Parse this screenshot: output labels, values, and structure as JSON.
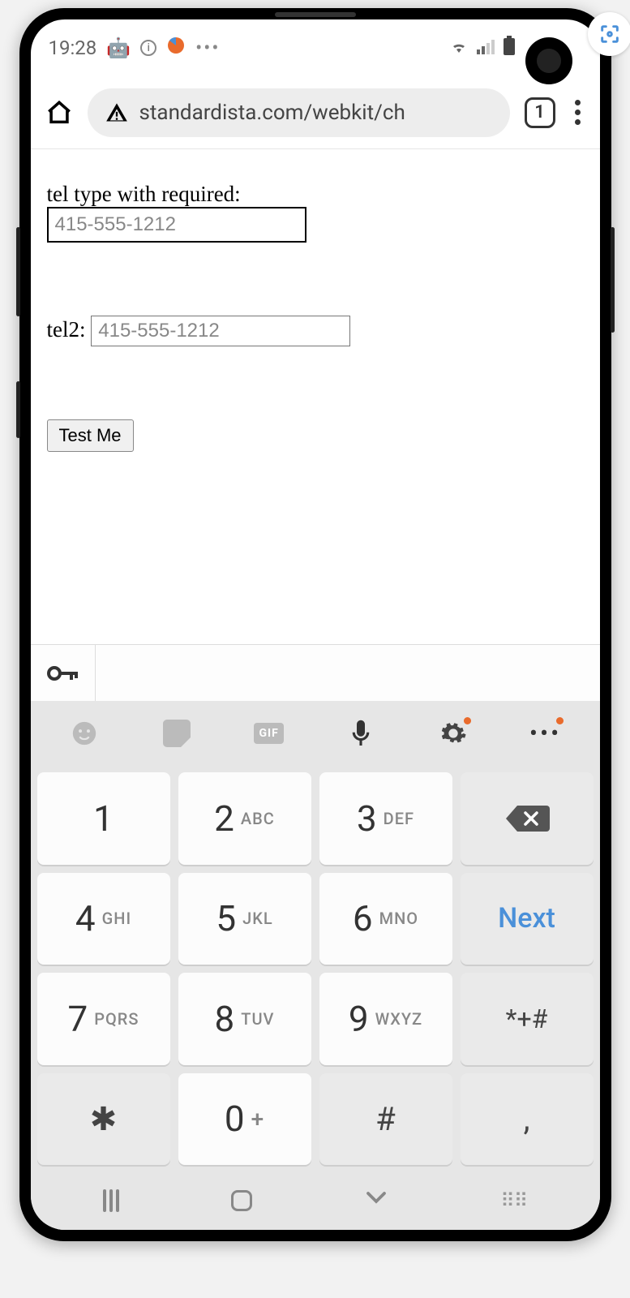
{
  "status": {
    "time": "19:28",
    "icons_left": [
      "android-icon",
      "info-icon",
      "browser-icon",
      "more-icon"
    ],
    "icons_right": [
      "wifi-icon",
      "signal-icon",
      "battery-icon"
    ]
  },
  "browser": {
    "url": "standardista.com/webkit/ch",
    "tab_count": "1"
  },
  "page": {
    "label1": "tel type with required:",
    "input1_placeholder": "415-555-1212",
    "label2": "tel2:",
    "input2_placeholder": "415-555-1212",
    "button": "Test Me"
  },
  "keyboard": {
    "toolbar": [
      "emoji",
      "sticker",
      "gif",
      "mic",
      "settings",
      "more"
    ],
    "keys": [
      {
        "num": "1",
        "sub": ""
      },
      {
        "num": "2",
        "sub": "ABC"
      },
      {
        "num": "3",
        "sub": "DEF"
      },
      {
        "type": "backspace"
      },
      {
        "num": "4",
        "sub": "GHI"
      },
      {
        "num": "5",
        "sub": "JKL"
      },
      {
        "num": "6",
        "sub": "MNO"
      },
      {
        "type": "next",
        "label": "Next"
      },
      {
        "num": "7",
        "sub": "PQRS"
      },
      {
        "num": "8",
        "sub": "TUV"
      },
      {
        "num": "9",
        "sub": "WXYZ"
      },
      {
        "type": "sym",
        "label": "*+#"
      },
      {
        "type": "sym",
        "label": "✱"
      },
      {
        "num": "0",
        "sub": "+"
      },
      {
        "type": "sym",
        "label": "#"
      },
      {
        "type": "sym",
        "label": ","
      }
    ]
  },
  "nav": [
    "recent",
    "home",
    "back",
    "keyboard-toggle"
  ]
}
